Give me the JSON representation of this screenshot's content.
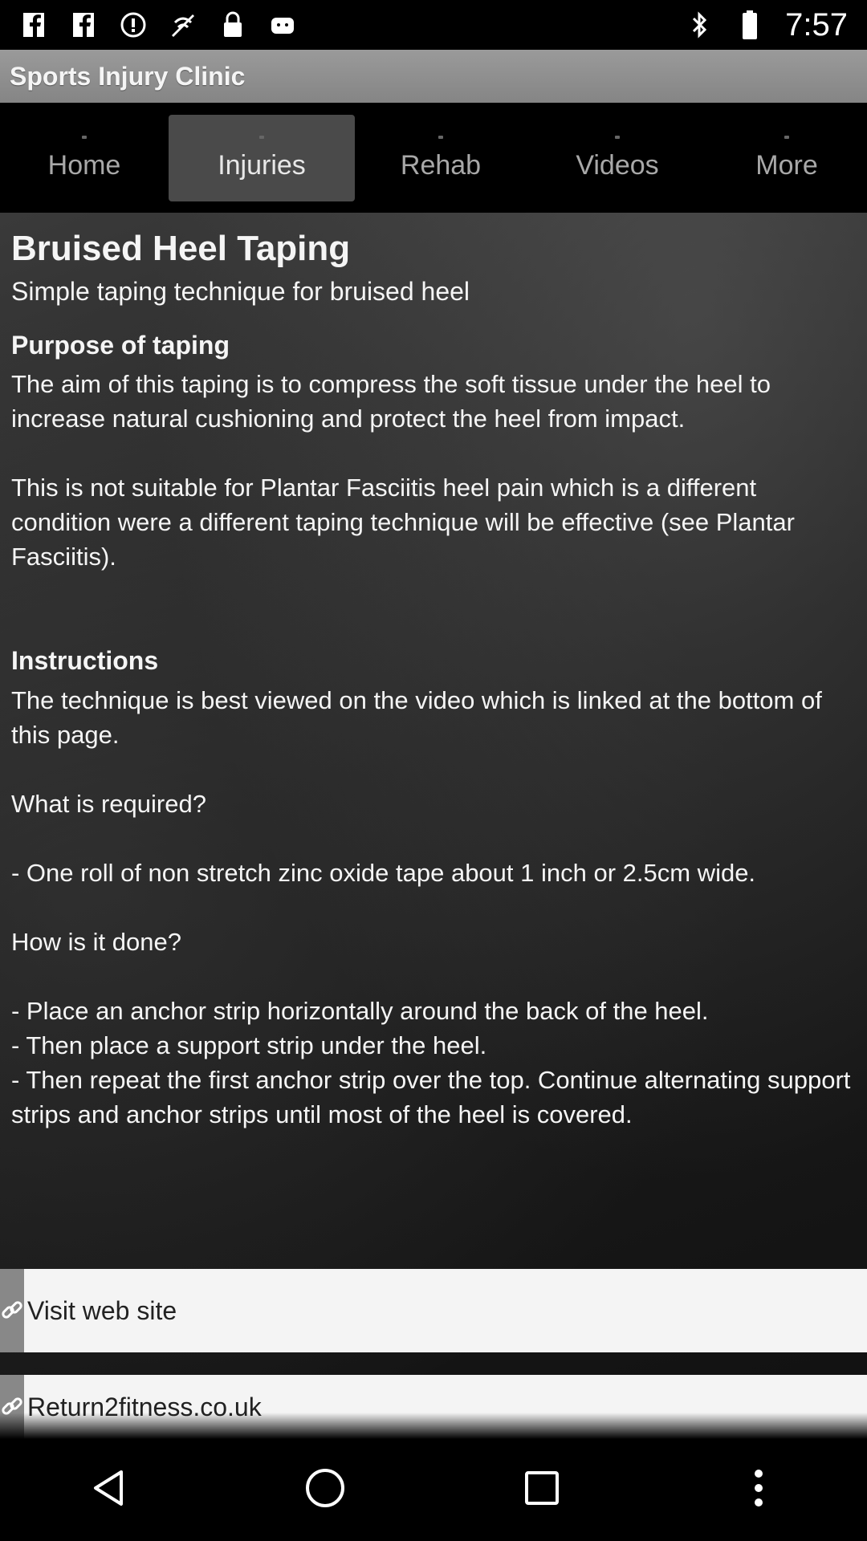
{
  "status": {
    "time": "7:57",
    "left_icons": [
      "facebook-icon",
      "facebook-icon",
      "alert-icon",
      "no-signal-icon",
      "lock-icon",
      "android-icon"
    ],
    "right_icons": [
      "bluetooth-icon",
      "battery-icon"
    ]
  },
  "app": {
    "title": "Sports Injury Clinic"
  },
  "tabs": [
    {
      "label": "Home",
      "active": false
    },
    {
      "label": "Injuries",
      "active": true
    },
    {
      "label": "Rehab",
      "active": false
    },
    {
      "label": "Videos",
      "active": false
    },
    {
      "label": "More",
      "active": false
    }
  ],
  "article": {
    "title": "Bruised Heel Taping",
    "subtitle": "Simple taping technique for bruised heel",
    "purpose_heading": "Purpose of taping",
    "purpose_text": "The aim of this taping is to compress the soft tissue under the heel to increase natural cushioning and protect the heel from impact.\n\nThis is not suitable for Plantar Fasciitis heel pain which is a different condition were a different taping technique will be effective (see Plantar Fasciitis).",
    "instructions_heading": "Instructions",
    "instructions_text": "The technique is best viewed on the video which is linked at the bottom of this page.\n\nWhat is required?\n\n- One roll of non stretch zinc oxide tape about 1 inch or 2.5cm wide.\n\nHow is it done?\n\n- Place an anchor strip horizontally around the back of the heel.\n- Then place a support strip under the heel.\n- Then repeat the first anchor strip over the top. Continue alternating support strips and anchor strips until most of the heel is covered."
  },
  "links": [
    {
      "label": "Visit web site",
      "icon": "link-icon"
    },
    {
      "label": "Return2fitness.co.uk",
      "icon": "link-icon"
    }
  ],
  "navbar": {
    "icons": [
      "back-icon",
      "home-icon",
      "recents-icon",
      "overflow-menu-icon"
    ]
  }
}
